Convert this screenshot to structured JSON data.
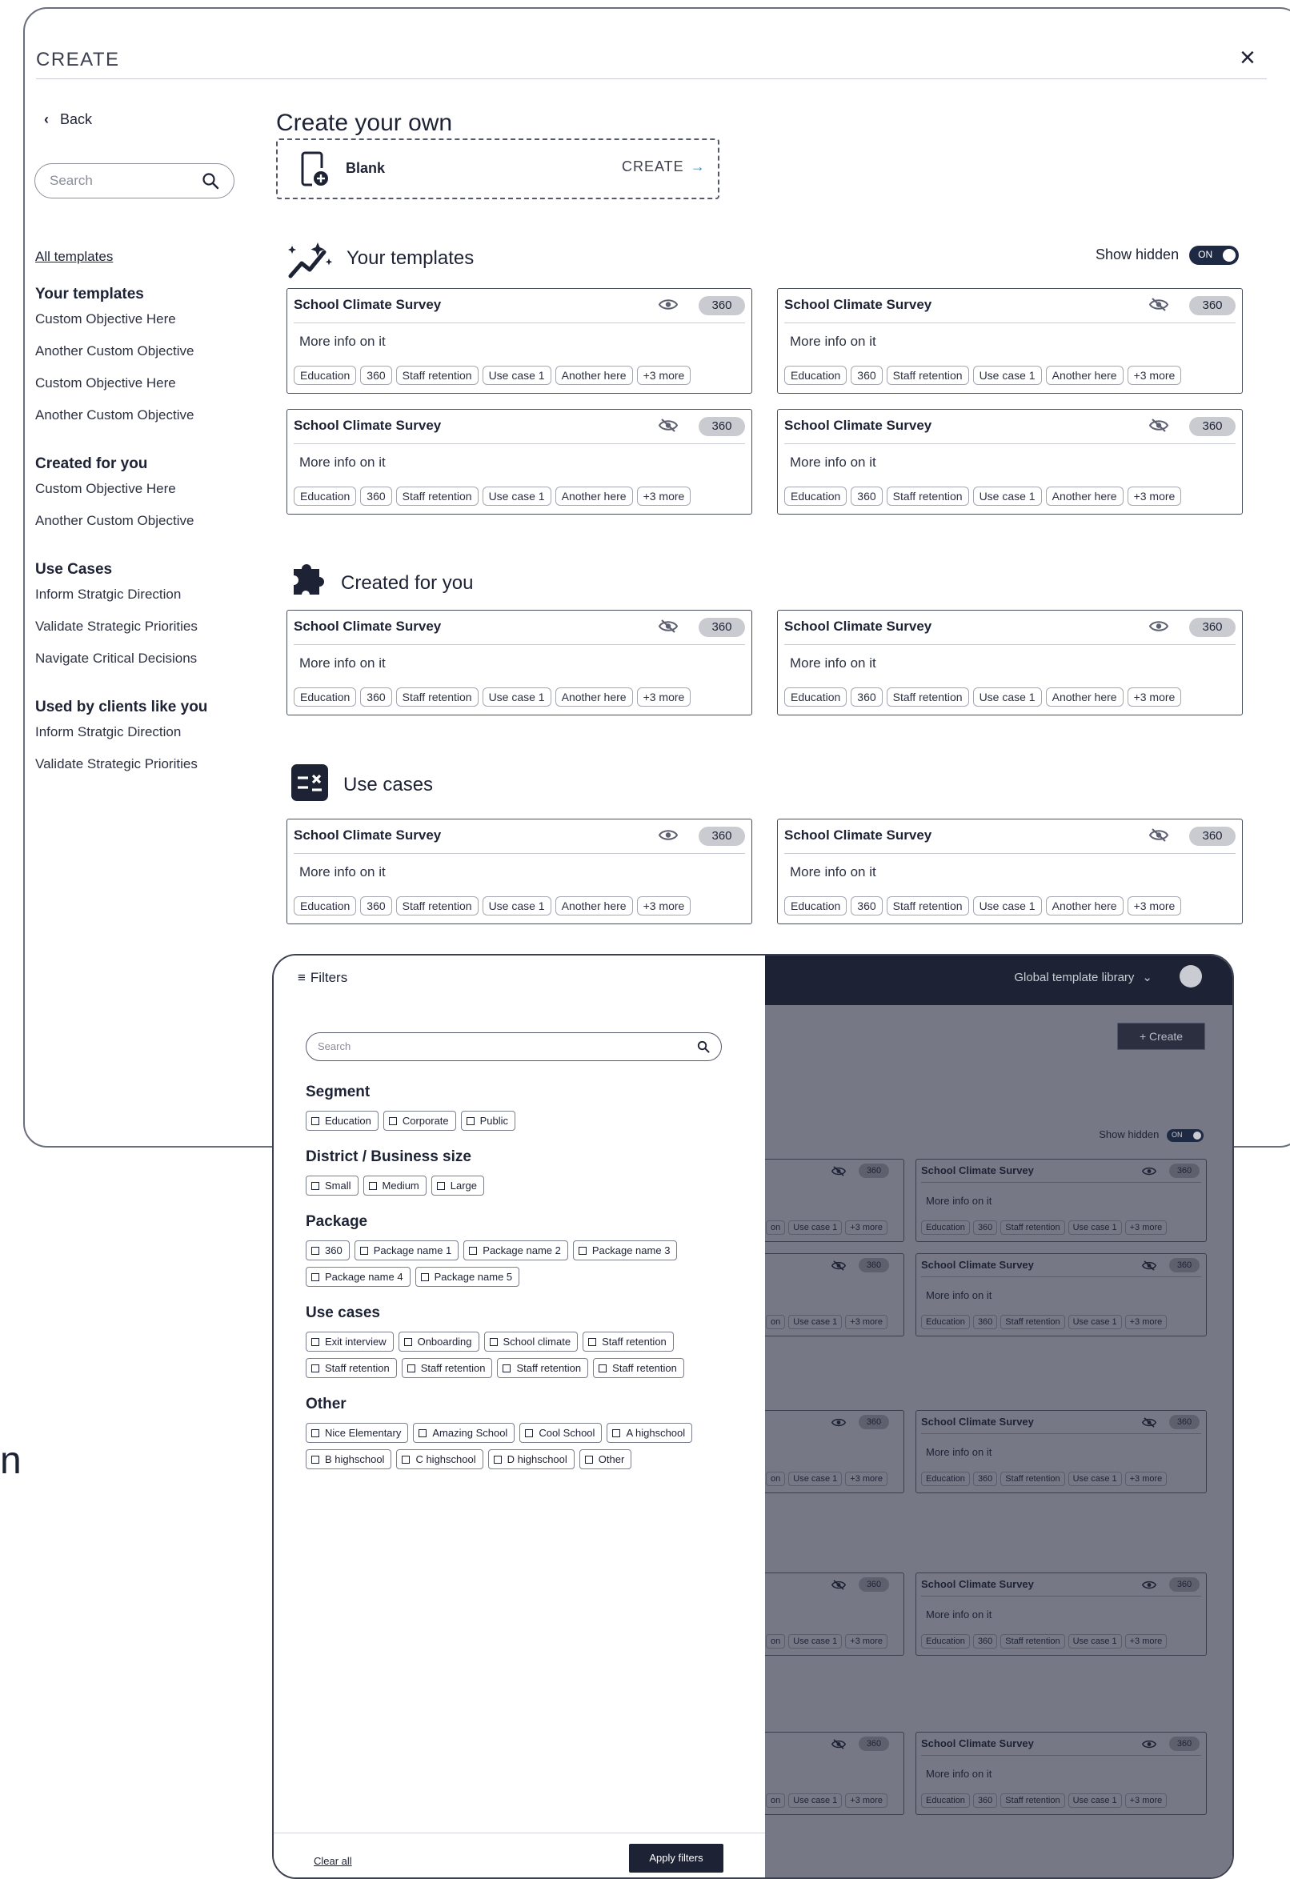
{
  "modal": {
    "title": "CREATE",
    "close_label": "×",
    "back_label": "Back",
    "search_placeholder": "Search",
    "nav": {
      "all_templates": "All templates",
      "groups": [
        {
          "title": "Your templates",
          "items": [
            "Custom Objective Here",
            "Another Custom Objective",
            "Custom Objective Here",
            "Another Custom Objective"
          ]
        },
        {
          "title": "Created for you",
          "items": [
            "Custom Objective Here",
            "Another Custom Objective"
          ]
        },
        {
          "title": "Use Cases",
          "items": [
            "Inform Stratgic Direction",
            "Validate Strategic Priorities",
            "Navigate Critical Decisions"
          ]
        },
        {
          "title": "Used by clients like you",
          "items": [
            "Inform Stratgic Direction",
            "Validate Strategic Priorities"
          ]
        }
      ]
    },
    "create_own": {
      "title": "Create your own",
      "blank_label": "Blank",
      "create_label": "CREATE",
      "arrow": "→"
    },
    "show_hidden": {
      "label": "Show hidden",
      "toggle": "ON"
    },
    "sections": {
      "your_templates": "Your templates",
      "created_for_you": "Created for you",
      "use_cases": "Use cases"
    },
    "card": {
      "name": "School Climate Survey",
      "badge": "360",
      "info": "More info on it",
      "tags": [
        "Education",
        "360",
        "Staff retention",
        "Use case 1",
        "Another here",
        "+3 more"
      ]
    },
    "card_visibility": {
      "your_templates": [
        "visible",
        "hidden",
        "hidden",
        "hidden"
      ],
      "created_for_you": [
        "hidden",
        "visible"
      ],
      "use_cases": [
        "visible",
        "hidden"
      ]
    }
  },
  "filters": {
    "header": "Filters",
    "search_placeholder": "Search",
    "groups": [
      {
        "title": "Segment",
        "options": [
          "Education",
          "Corporate",
          "Public"
        ]
      },
      {
        "title": "District / Business size",
        "options": [
          "Small",
          "Medium",
          "Large"
        ]
      },
      {
        "title": "Package",
        "options": [
          "360",
          "Package name 1",
          "Package name 2",
          "Package name 3",
          "Package name 4",
          "Package name 5"
        ]
      },
      {
        "title": "Use cases",
        "options": [
          "Exit interview",
          "Onboarding",
          "School climate",
          "Staff retention",
          "Staff retention",
          "Staff retention",
          "Staff retention",
          "Staff retention"
        ]
      },
      {
        "title": "Other",
        "options": [
          "Nice Elementary",
          "Amazing School",
          "Cool School",
          "A highschool",
          "B highschool",
          "C highschool",
          "D highschool",
          "Other"
        ]
      }
    ],
    "clear_all": "Clear all",
    "apply": "Apply filters"
  },
  "background_app": {
    "title": "Global template library",
    "create_label": "+  Create",
    "show_hidden": "Show hidden",
    "toggle": "ON",
    "card_name": "School Climate Survey",
    "badge": "360",
    "info": "More info on it",
    "right_tags": [
      "Education",
      "360",
      "Staff retention",
      "Use case 1",
      "+3 more"
    ],
    "left_tags": [
      "on",
      "Use case 1",
      "+3 more"
    ],
    "right_visibility": [
      "visible",
      "hidden",
      "hidden",
      "visible",
      "visible"
    ],
    "left_visibility": [
      "hidden",
      "hidden",
      "visible",
      "hidden",
      "hidden"
    ]
  },
  "stray_text": "n",
  "colors": {
    "primary": "#1e2235",
    "accent_arrow": "#1a8fd8",
    "badge": "#c9cbd1",
    "overlay": "#767985"
  }
}
